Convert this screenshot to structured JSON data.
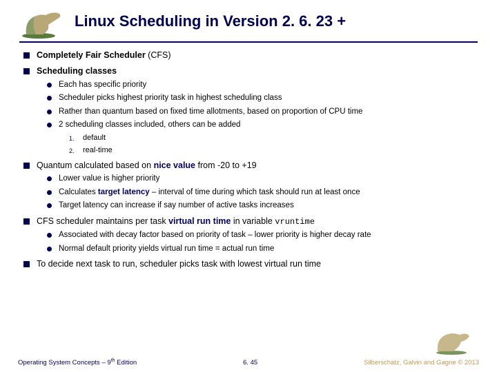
{
  "title": "Linux Scheduling in Version 2. 6. 23 +",
  "b1": {
    "pre": "Completely Fair Scheduler",
    "post": " (CFS)"
  },
  "b2": "Scheduling classes",
  "b2a": "Each has specific priority",
  "b2b": "Scheduler picks highest priority task in highest scheduling class",
  "b2c": "Rather than quantum based on fixed time allotments, based on proportion of CPU time",
  "b2d": "2 scheduling classes included, others can be added",
  "b2d1": "default",
  "b2d2": "real-time",
  "b3": {
    "pre": "Quantum calculated based on ",
    "accent": "nice value",
    "post": " from -20 to +19"
  },
  "b3a": "Lower value is higher priority",
  "b3b": {
    "pre": "Calculates ",
    "accent": "target latency",
    "post": " – interval of time during which task should run at least once"
  },
  "b3c": "Target latency can increase if say number of active tasks increases",
  "b4": {
    "pre": "CFS scheduler maintains per task ",
    "accent": "virtual run time",
    "post1": " in variable ",
    "code": "vruntime"
  },
  "b4a": "Associated with decay factor based on priority of task – lower priority is higher decay rate",
  "b4b": "Normal default priority yields virtual run time = actual run time",
  "b5": "To decide next task to run, scheduler picks task with lowest virtual run time",
  "footer": {
    "left_pre": "Operating System Concepts – 9",
    "left_sup": "th",
    "left_post": " Edition",
    "mid": "6. 45",
    "right": "Silberschatz, Galvin and Gagne © 2013"
  }
}
